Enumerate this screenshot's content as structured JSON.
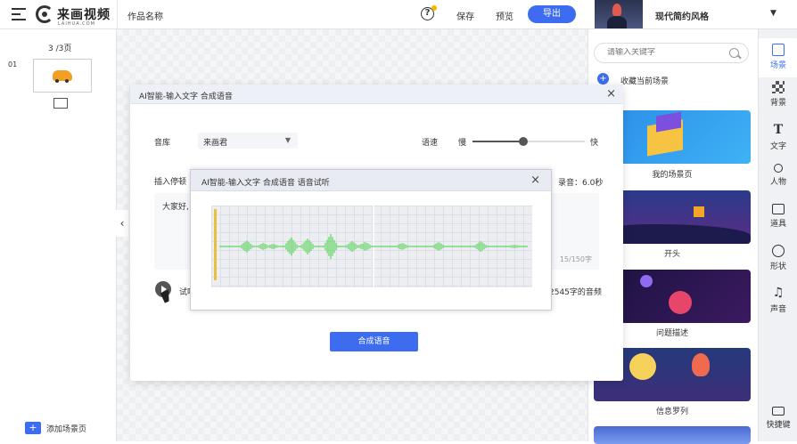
{
  "header": {
    "logo_text": "来画视频",
    "logo_sub": "LAIHUA.COM",
    "work_name": "作品名称",
    "save_label": "保存",
    "preview_label": "预览",
    "export_label": "导出",
    "style_name": "现代简约风格"
  },
  "pages": {
    "count": "3 /3页",
    "items": [
      {
        "num": "01"
      }
    ],
    "add_scene": "添加场景页"
  },
  "right_panel": {
    "search_placeholder": "请输入关键字",
    "collect_label": "收藏当前场景",
    "scenes": [
      {
        "label": "我的场景页"
      },
      {
        "label": "开头"
      },
      {
        "label": "问题描述"
      },
      {
        "label": "信息罗列"
      }
    ]
  },
  "tabs": [
    {
      "label": "场景",
      "icon": "scene-icon"
    },
    {
      "label": "背景",
      "icon": "background-icon"
    },
    {
      "label": "文字",
      "icon": "text-icon"
    },
    {
      "label": "人物",
      "icon": "person-icon"
    },
    {
      "label": "道具",
      "icon": "tool-icon"
    },
    {
      "label": "形状",
      "icon": "shape-icon"
    },
    {
      "label": "声音",
      "icon": "sound-icon"
    },
    {
      "label": "快捷键",
      "icon": "keyboard-icon"
    }
  ],
  "dialog1": {
    "title": "AI智能-输入文字 合成语音",
    "lib_label": "音库",
    "lib_value": "来画君",
    "speed_label": "语速",
    "slow": "慢",
    "fast": "快",
    "speed_fraction": 0.45,
    "pause_label": "插入停顿",
    "rec_label": "录音：6.0秒",
    "text_value": "大家好,",
    "char_count": "15/150字",
    "audition_label": "试听",
    "audio_note": "2545字的音频",
    "synth_label": "合成语音"
  },
  "dialog2": {
    "title": "AI智能-输入文字 合成语音  语音试听"
  },
  "colors": {
    "accent": "#3d6cf0",
    "wave": "#5fd35f",
    "marker": "#e8c040"
  }
}
